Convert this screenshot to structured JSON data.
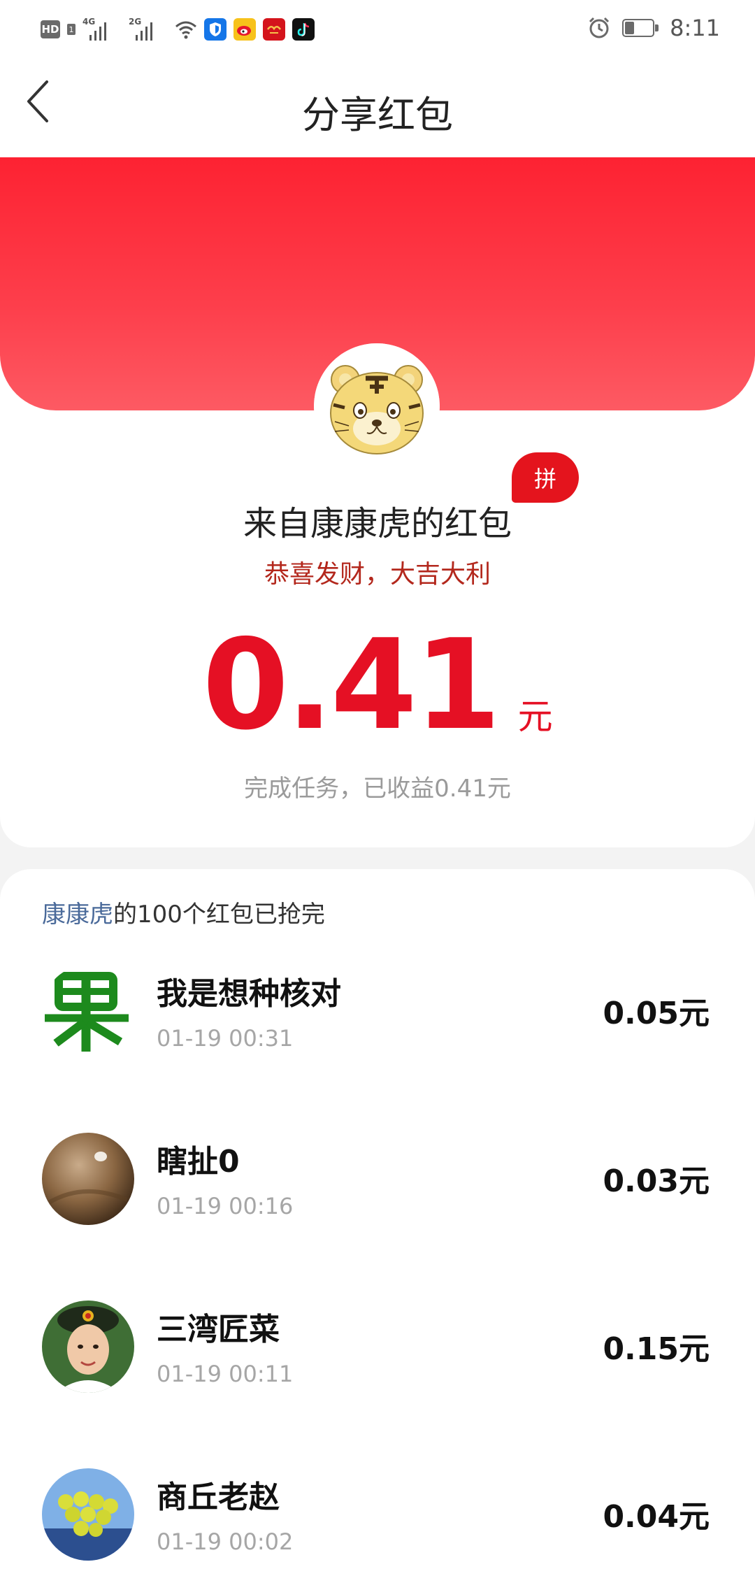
{
  "status_bar": {
    "time": "8:11",
    "signal_1_label": "4G",
    "signal_2_label": "2G",
    "hd_label": "HD",
    "hd_sub": "1",
    "battery_level": 0.35,
    "icons": [
      "wifi-icon",
      "shield-app-icon",
      "weibo-app-icon",
      "xuexi-app-icon",
      "tiktok-app-icon",
      "alarm-icon",
      "battery-icon"
    ]
  },
  "nav": {
    "title": "分享红包",
    "back_icon": "chevron-left-icon"
  },
  "envelope": {
    "badge": "拼",
    "from_title": "来自康康虎的红包",
    "blessing": "恭喜发财，大吉大利",
    "amount": "0.41",
    "unit": "元",
    "income_note": "完成任务，已收益0.41元",
    "colors": {
      "header_red": "#fd2232",
      "amount_red": "#e51024",
      "blessing": "#b3271c"
    }
  },
  "list": {
    "summary_name": "康康虎",
    "summary_rest": "的100个红包已抢完",
    "rows": [
      {
        "name": "我是想种核对",
        "time": "01-19 00:31",
        "amount": "0.05元"
      },
      {
        "name": "瞎扯0",
        "time": "01-19 00:16",
        "amount": "0.03元"
      },
      {
        "name": "三湾匠菜",
        "time": "01-19 00:11",
        "amount": "0.15元"
      },
      {
        "name": "商丘老赵",
        "time": "01-19 00:02",
        "amount": "0.04元"
      }
    ]
  }
}
